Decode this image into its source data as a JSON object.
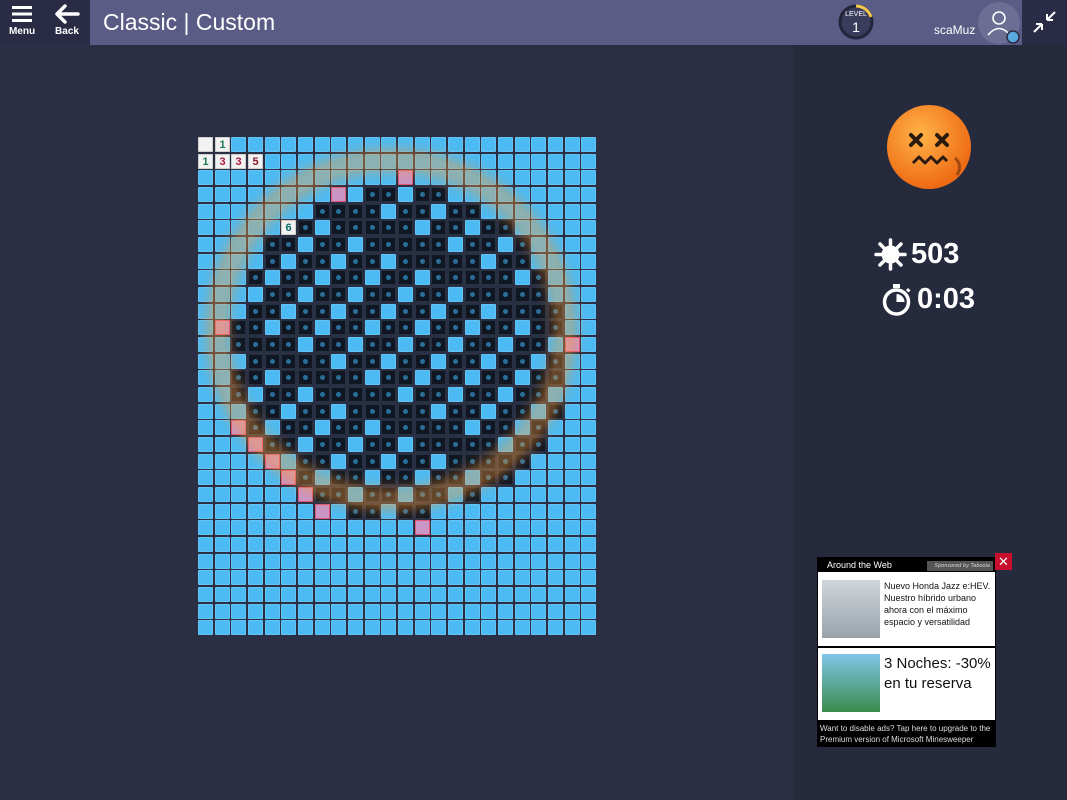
{
  "header": {
    "menu_label": "Menu",
    "back_label": "Back",
    "title": "Classic | Custom",
    "level_label": "LEVEL",
    "level_value": "1",
    "username": "scaMuz"
  },
  "stats": {
    "mines_remaining": "503",
    "timer": "0:03"
  },
  "board": {
    "columns": 24,
    "rows": 30,
    "numbered_cells": [
      {
        "row": 0,
        "col": 0,
        "value": ""
      },
      {
        "row": 0,
        "col": 1,
        "value": "1"
      },
      {
        "row": 1,
        "col": 0,
        "value": "1"
      },
      {
        "row": 1,
        "col": 1,
        "value": "3"
      },
      {
        "row": 1,
        "col": 2,
        "value": "3"
      },
      {
        "row": 1,
        "col": 3,
        "value": "5"
      },
      {
        "row": 5,
        "col": 5,
        "value": "6"
      }
    ],
    "colors": {
      "covered": "#4dbbf3",
      "mine": "#111722",
      "flag_wrong": "#c996c6",
      "open": "#f2f2f2",
      "number_1": "#1a7a4f",
      "number_3": "#b2163d",
      "number_5": "#8a1a2a",
      "number_6": "#0e6b6b"
    }
  },
  "ad": {
    "header": "Around the Web",
    "sponsor": "Sponsored by Taboola",
    "items": [
      {
        "text": "Nuevo Honda Jazz e:HEV. Nuestro híbrido urbano ahora con el máximo espacio y versatilidad"
      },
      {
        "text": "3 Noches: -30% en tu reserva"
      }
    ],
    "footer": "Want to disable ads? Tap here to upgrade to the Premium version of Microsoft Minesweeper",
    "close_label": "✕"
  },
  "icons": {
    "menu": "hamburger-icon",
    "back": "arrow-left-icon",
    "collapse": "collapse-arrows-icon",
    "mine": "mine-icon",
    "timer": "stopwatch-icon",
    "emoji": "dead-face-icon"
  }
}
